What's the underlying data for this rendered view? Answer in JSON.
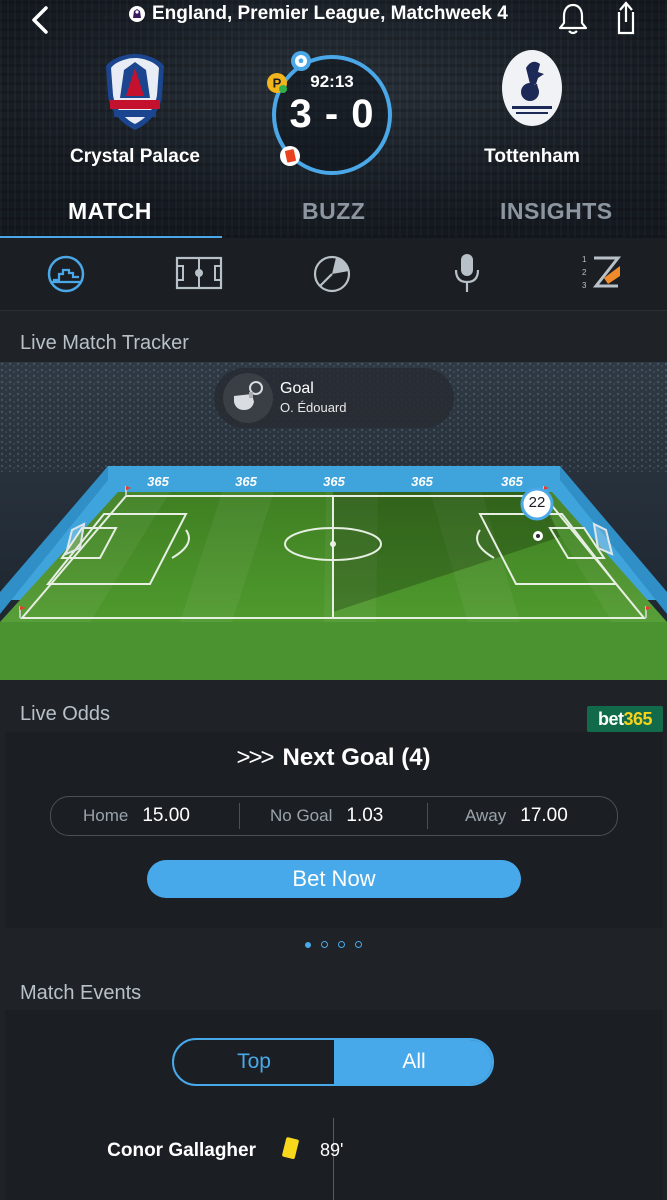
{
  "header": {
    "league": "England, Premier League, Matchweek 4",
    "home_team": "Crystal Palace",
    "away_team": "Tottenham",
    "match_time": "92:13",
    "score": "3 - 0",
    "icons": [
      "back-arrow-icon",
      "premier-league-icon",
      "bell-icon",
      "share-icon"
    ]
  },
  "tabs": [
    {
      "label": "MATCH",
      "active": true
    },
    {
      "label": "BUZZ",
      "active": false
    },
    {
      "label": "INSIGHTS",
      "active": false
    }
  ],
  "icon_bar": [
    "stats-gauge-icon",
    "pitch-lineup-icon",
    "possession-pie-icon",
    "microphone-icon",
    "live-standings-icon"
  ],
  "tracker": {
    "title": "Live Match Tracker",
    "event_type": "Goal",
    "event_player": "O. Édouard",
    "player_number": "22",
    "board_text": "365"
  },
  "odds": {
    "title": "Live Odds",
    "provider": {
      "part1": "bet",
      "part2": "365"
    },
    "market": "Next Goal (4)",
    "chevrons": ">>>",
    "options": [
      {
        "label": "Home",
        "value": "15.00"
      },
      {
        "label": "No Goal",
        "value": "1.03"
      },
      {
        "label": "Away",
        "value": "17.00"
      }
    ],
    "cta": "Bet Now",
    "pages": 4,
    "active_page": 1
  },
  "events": {
    "title": "Match Events",
    "filters": {
      "top": "Top",
      "all": "All"
    },
    "selected_filter": "All",
    "items": [
      {
        "player": "Conor Gallagher",
        "type": "yellow-card",
        "minute": "89'"
      }
    ]
  },
  "colors": {
    "accent": "#48a9ea",
    "background": "#1f2327",
    "card": "#1b1f23",
    "pitch": "#4f9a2e",
    "board": "#3fa4dc",
    "bet365_green": "#116b4b",
    "bet365_yellow": "#f6d21a",
    "yellow_card": "#f8d81c"
  }
}
